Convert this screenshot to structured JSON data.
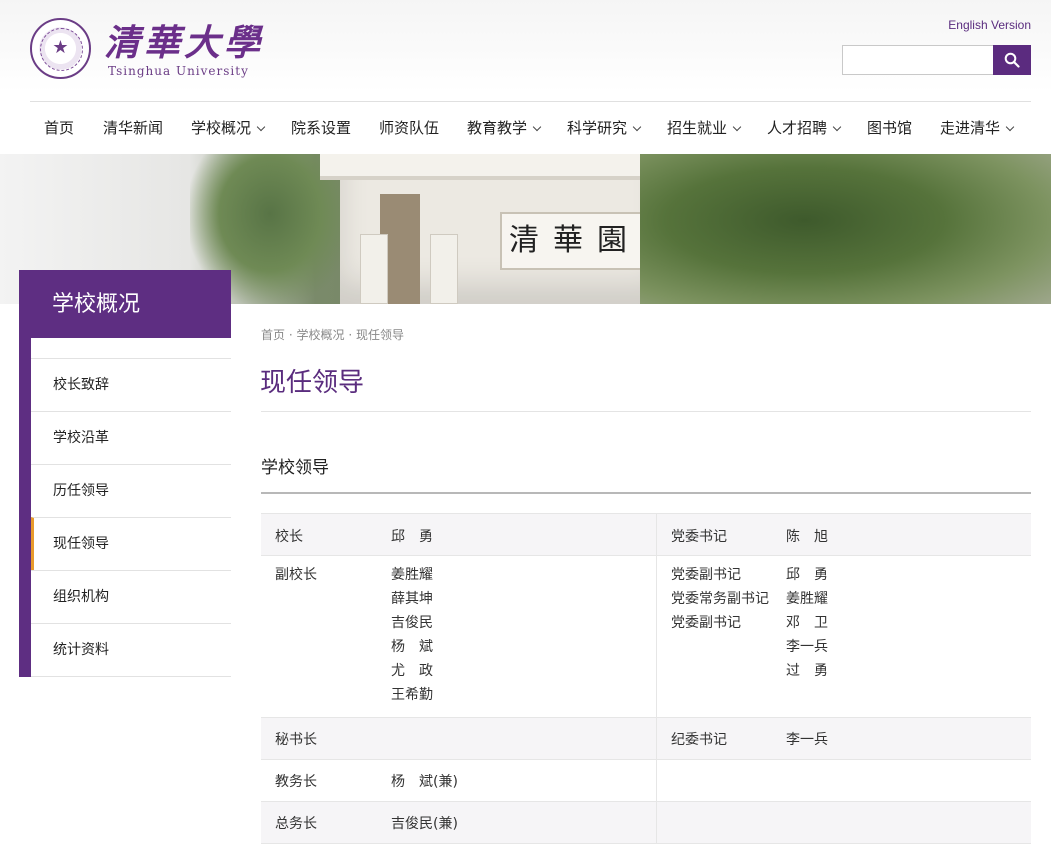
{
  "header": {
    "logo_cn": "清華大學",
    "logo_en": "Tsinghua University",
    "english_link": "English Version",
    "search_placeholder": ""
  },
  "nav": [
    {
      "label": "首页",
      "dropdown": false
    },
    {
      "label": "清华新闻",
      "dropdown": false
    },
    {
      "label": "学校概况",
      "dropdown": true
    },
    {
      "label": "院系设置",
      "dropdown": false
    },
    {
      "label": "师资队伍",
      "dropdown": false
    },
    {
      "label": "教育教学",
      "dropdown": true
    },
    {
      "label": "科学研究",
      "dropdown": true
    },
    {
      "label": "招生就业",
      "dropdown": true
    },
    {
      "label": "人才招聘",
      "dropdown": true
    },
    {
      "label": "图书馆",
      "dropdown": false
    },
    {
      "label": "走进清华",
      "dropdown": true
    }
  ],
  "banner": {
    "plaque_text": "清華園"
  },
  "sidebar": {
    "title": "学校概况",
    "items": [
      {
        "label": "校长致辞",
        "active": false
      },
      {
        "label": "学校沿革",
        "active": false
      },
      {
        "label": "历任领导",
        "active": false
      },
      {
        "label": "现任领导",
        "active": true
      },
      {
        "label": "组织机构",
        "active": false
      },
      {
        "label": "统计资料",
        "active": false
      }
    ]
  },
  "breadcrumb": {
    "home": "首页",
    "section": "学校概况",
    "current": "现任领导",
    "separator": "·"
  },
  "page_title": "现任领导",
  "section_title": "学校领导",
  "leaders": {
    "president": {
      "label": "校长",
      "names": [
        "邱　勇"
      ]
    },
    "party_secretary": {
      "label": "党委书记",
      "names": [
        "陈　旭"
      ]
    },
    "vice_presidents": {
      "label": "副校长",
      "names": [
        "姜胜耀",
        "薛其坤",
        "吉俊民",
        "杨　斌",
        "尤　政",
        "王希勤"
      ]
    },
    "deputy_secretaries": {
      "labels": [
        "党委副书记",
        "党委常务副书记",
        "党委副书记"
      ],
      "names": [
        "邱　勇",
        "姜胜耀",
        "邓　卫",
        "李一兵",
        "过　勇"
      ]
    },
    "secretary_general": {
      "label": "秘书长",
      "names": []
    },
    "discipline_secretary": {
      "label": "纪委书记",
      "names": [
        "李一兵"
      ]
    },
    "provost": {
      "label": "教务长",
      "names": [
        "杨　斌(兼)"
      ]
    },
    "general_affairs": {
      "label": "总务长",
      "names": [
        "吉俊民(兼)"
      ]
    }
  },
  "colors": {
    "brand_purple": "#5e2e82",
    "active_accent": "#e89a2c",
    "row_shade": "#f6f5f7"
  }
}
